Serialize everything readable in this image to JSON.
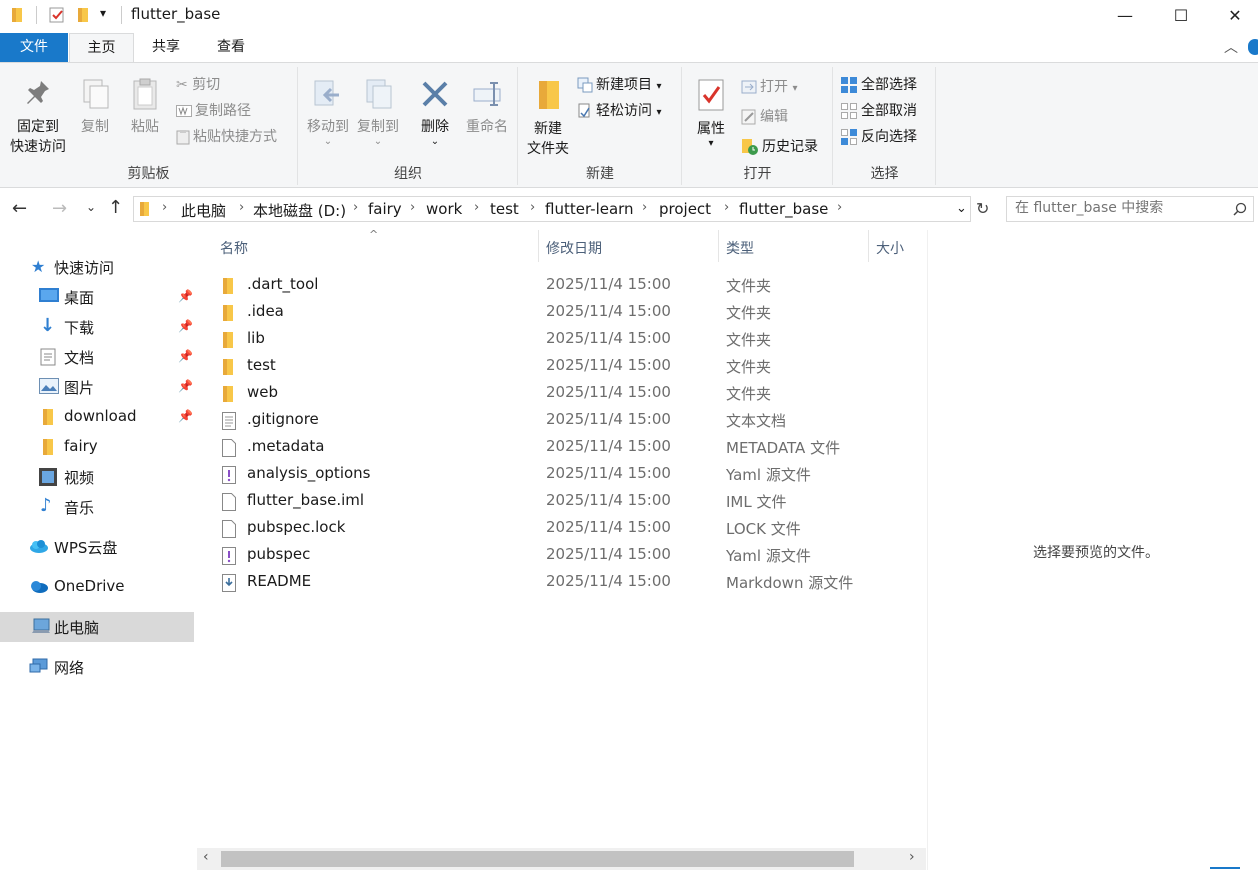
{
  "window": {
    "title": "flutter_base"
  },
  "window_controls": {
    "minimize": "—",
    "maximize": "☐",
    "close": "✕"
  },
  "ribbon_tabs": [
    {
      "label": "文件"
    },
    {
      "label": "主页"
    },
    {
      "label": "共享"
    },
    {
      "label": "查看"
    }
  ],
  "clipboard": {
    "pin_line1": "固定到",
    "pin_line2": "快速访问",
    "copy": "复制",
    "paste": "粘贴",
    "cut": "剪切",
    "copy_path": "复制路径",
    "paste_shortcut": "粘贴快捷方式",
    "group_label": "剪贴板"
  },
  "organize": {
    "move_to": "移动到",
    "copy_to": "复制到",
    "delete": "删除",
    "rename": "重命名",
    "group_label": "组织"
  },
  "new_group": {
    "new_folder_line1": "新建",
    "new_folder_line2": "文件夹",
    "new_item": "新建项目",
    "easy_access": "轻松访问",
    "group_label": "新建"
  },
  "open_group": {
    "properties": "属性",
    "open": "打开",
    "edit": "编辑",
    "history": "历史记录",
    "group_label": "打开"
  },
  "select_group": {
    "select_all": "全部选择",
    "select_none": "全部取消",
    "invert": "反向选择",
    "group_label": "选择"
  },
  "address": {
    "crumbs": [
      "此电脑",
      "本地磁盘 (D:)",
      "fairy",
      "work",
      "test",
      "flutter-learn",
      "project",
      "flutter_base"
    ]
  },
  "search": {
    "placeholder": "在 flutter_base 中搜索"
  },
  "nav": {
    "quick_access": "快速访问",
    "items": [
      {
        "label": "桌面",
        "pinned": true
      },
      {
        "label": "下载",
        "pinned": true
      },
      {
        "label": "文档",
        "pinned": true
      },
      {
        "label": "图片",
        "pinned": true
      },
      {
        "label": "download",
        "pinned": true
      },
      {
        "label": "fairy",
        "pinned": false
      },
      {
        "label": "视频",
        "pinned": false
      },
      {
        "label": "音乐",
        "pinned": false
      }
    ],
    "wps": "WPS云盘",
    "onedrive": "OneDrive",
    "this_pc": "此电脑",
    "network": "网络"
  },
  "columns": {
    "name": "名称",
    "date": "修改日期",
    "type": "类型",
    "size": "大小"
  },
  "files": [
    {
      "name": ".dart_tool",
      "date": "2025/11/4 15:00",
      "type": "文件夹",
      "icon": "folder-icon"
    },
    {
      "name": ".idea",
      "date": "2025/11/4 15:00",
      "type": "文件夹",
      "icon": "folder-icon"
    },
    {
      "name": "lib",
      "date": "2025/11/4 15:00",
      "type": "文件夹",
      "icon": "folder-icon"
    },
    {
      "name": "test",
      "date": "2025/11/4 15:00",
      "type": "文件夹",
      "icon": "folder-icon"
    },
    {
      "name": "web",
      "date": "2025/11/4 15:00",
      "type": "文件夹",
      "icon": "folder-icon"
    },
    {
      "name": ".gitignore",
      "date": "2025/11/4 15:00",
      "type": "文本文档",
      "icon": "text-file-icon"
    },
    {
      "name": ".metadata",
      "date": "2025/11/4 15:00",
      "type": "METADATA 文件",
      "icon": "blank-file-icon"
    },
    {
      "name": "analysis_options",
      "date": "2025/11/4 15:00",
      "type": "Yaml 源文件",
      "icon": "yaml-file-icon"
    },
    {
      "name": "flutter_base.iml",
      "date": "2025/11/4 15:00",
      "type": "IML 文件",
      "icon": "blank-file-icon"
    },
    {
      "name": "pubspec.lock",
      "date": "2025/11/4 15:00",
      "type": "LOCK 文件",
      "icon": "blank-file-icon"
    },
    {
      "name": "pubspec",
      "date": "2025/11/4 15:00",
      "type": "Yaml 源文件",
      "icon": "yaml-file-icon"
    },
    {
      "name": "README",
      "date": "2025/11/4 15:00",
      "type": "Markdown 源文件",
      "icon": "markdown-file-icon"
    }
  ],
  "preview": {
    "message": "选择要预览的文件。"
  },
  "colors": {
    "accent": "#1979ca",
    "folder": "#f8c749",
    "selected": "#d9d9d9"
  }
}
